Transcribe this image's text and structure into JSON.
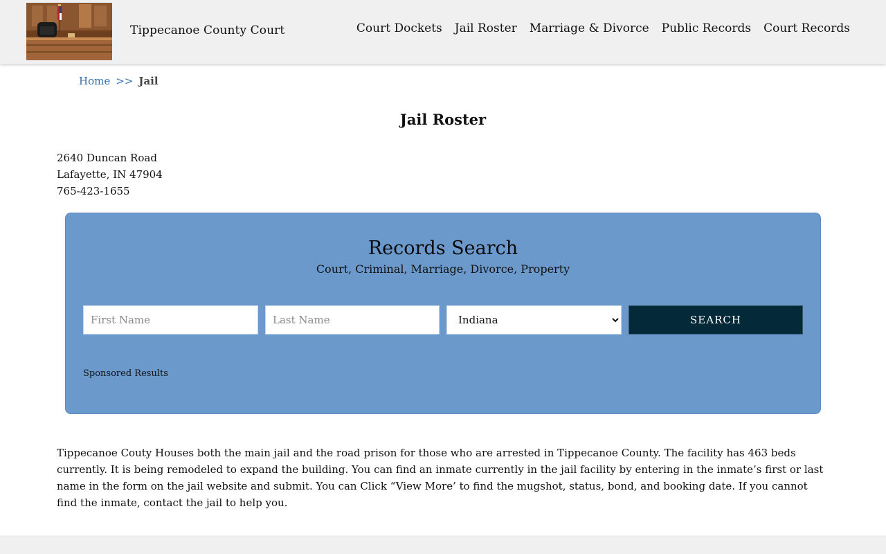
{
  "site": {
    "title": "Tippecanoe County Court"
  },
  "nav": [
    {
      "label": "Court Dockets"
    },
    {
      "label": "Jail Roster"
    },
    {
      "label": "Marriage & Divorce"
    },
    {
      "label": "Public Records"
    },
    {
      "label": "Court Records"
    }
  ],
  "breadcrumb": {
    "home": "Home",
    "separator": ">>",
    "current": "Jail"
  },
  "page": {
    "title": "Jail Roster"
  },
  "address": {
    "street": "2640 Duncan Road",
    "city": "Lafayette, IN 47904",
    "phone": "765-423-1655"
  },
  "search": {
    "title": "Records Search",
    "subtitle": "Court, Criminal, Marriage, Divorce, Property",
    "first_placeholder": "First Name",
    "last_placeholder": "Last Name",
    "state_selected": "Indiana",
    "button_label": "SEARCH",
    "sponsored": "Sponsored Results"
  },
  "content": {
    "paragraph": "Tippecanoe Couty Houses both the main jail and the road prison for those who are arrested in Tippecanoe County. The facility has 463 beds currently. It is being remodeled to expand the building. You can find an inmate currently in the jail facility by entering in the inmate’s first or last name in the form on the jail website and submit. You can Click “View More’ to find the mugshot, status, bond, and booking date. If you cannot find the inmate, contact the jail to help you."
  },
  "colors": {
    "panel": "#6b99cc",
    "button": "#042a3a",
    "link": "#2d6fb4",
    "header": "#f0f0f0"
  }
}
